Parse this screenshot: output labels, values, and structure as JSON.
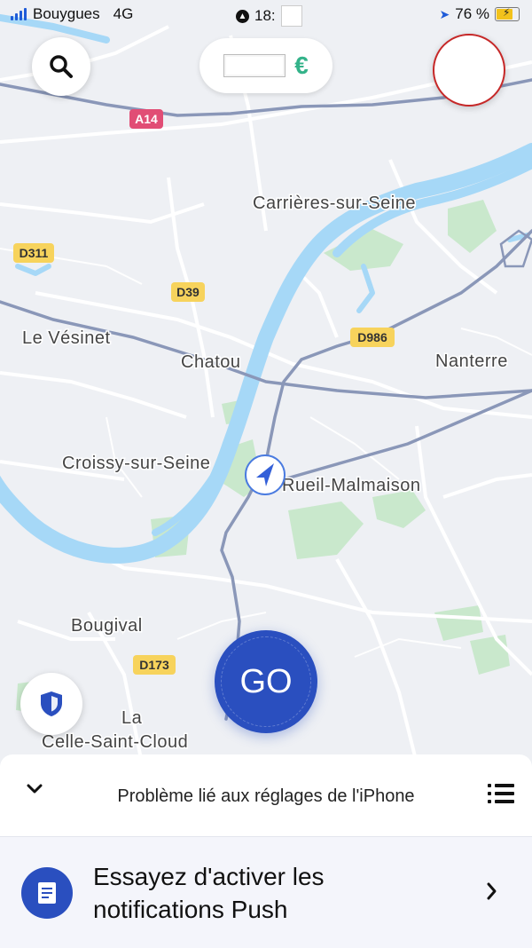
{
  "status_bar": {
    "carrier": "Bouygues",
    "network": "4G",
    "time_visible": "18:",
    "battery_percent": "76 %",
    "battery_level": 0.76,
    "colors": {
      "signal": "#1e5bd8",
      "battery": "#f2c21b"
    }
  },
  "map": {
    "labels": {
      "a14": "A14",
      "d311": "D311",
      "d39": "D39",
      "d986": "D986",
      "d173": "D173",
      "carrieres": "Carrières-sur-Seine",
      "le_vesinet": "Le Vésinet",
      "chatou": "Chatou",
      "nanterre": "Nanterre",
      "croissy": "Croissy-sur-Seine",
      "rueil": "Rueil-Malmaison",
      "bougival": "Bougival",
      "la": "La",
      "celle": "Celle-Saint-Cloud"
    },
    "colors": {
      "water": "#a6d8f7",
      "park": "#c9e8cc",
      "road": "#ffffff",
      "major_road": "#8a97b8"
    }
  },
  "controls": {
    "search_icon": "search-icon",
    "earnings_currency": "€",
    "profile_icon": "profile-avatar",
    "shield_icon": "shield-icon",
    "go_label": "GO",
    "colors": {
      "go": "#2a4fbf",
      "earnings": "#34b38a"
    }
  },
  "sheet": {
    "collapse_icon": "chevron-down-icon",
    "title": "Problème lié aux réglages de l'iPhone",
    "menu_icon": "list-icon",
    "notification": {
      "icon": "document-icon",
      "line1": "Essayez d'activer les",
      "line2": "notifications Push",
      "arrow_icon": "chevron-right-icon"
    }
  }
}
